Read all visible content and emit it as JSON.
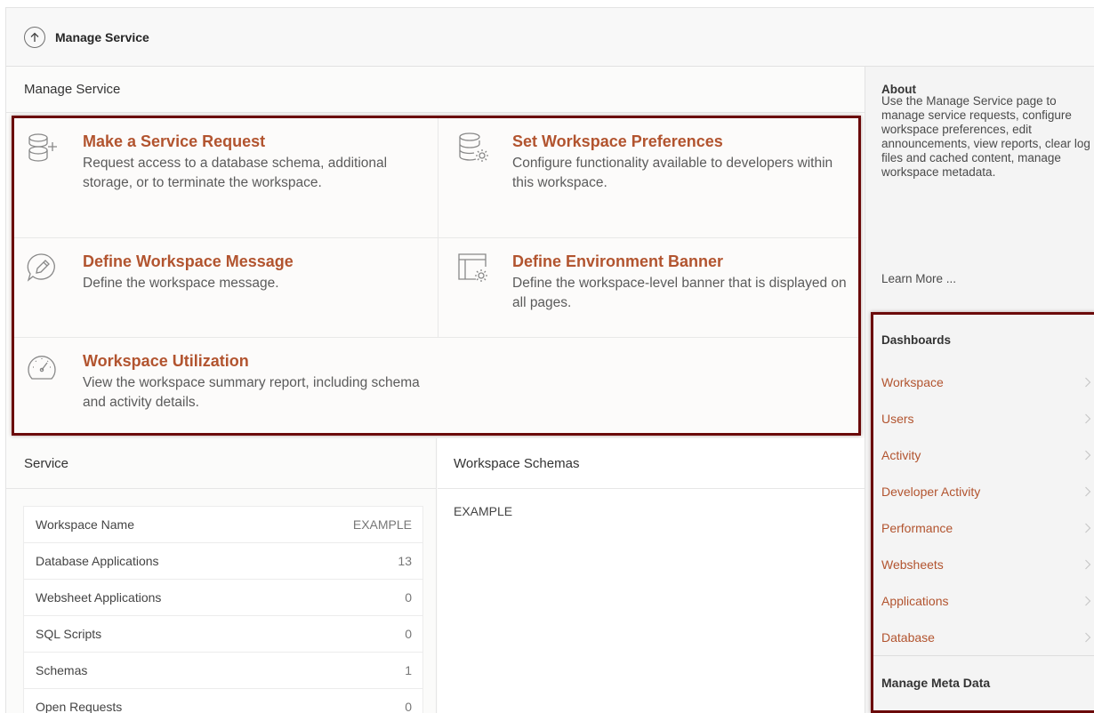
{
  "topbar": {
    "title": "Manage Service",
    "up_icon": "arrow-up-icon"
  },
  "main": {
    "header": "Manage Service",
    "cards": [
      {
        "title": "Make a Service Request",
        "description": "Request access to a database schema, additional storage, or to terminate the workspace.",
        "icon": "database-plus-icon"
      },
      {
        "title": "Set Workspace Preferences",
        "description": "Configure functionality available to developers within this workspace.",
        "icon": "database-gear-icon"
      },
      {
        "title": "Define Workspace Message",
        "description": "Define the workspace message.",
        "icon": "speech-pencil-icon"
      },
      {
        "title": "Define Environment Banner",
        "description": "Define the workspace-level banner that is displayed on all pages.",
        "icon": "window-gear-icon"
      },
      {
        "title": "Workspace Utilization",
        "description": "View the workspace summary report, including schema and activity details.",
        "icon": "gauge-icon"
      }
    ]
  },
  "service": {
    "header": "Service",
    "rows": [
      {
        "label": "Workspace Name",
        "value": "EXAMPLE"
      },
      {
        "label": "Database Applications",
        "value": "13"
      },
      {
        "label": "Websheet Applications",
        "value": "0"
      },
      {
        "label": "SQL Scripts",
        "value": "0"
      },
      {
        "label": "Schemas",
        "value": "1"
      },
      {
        "label": "Open Requests",
        "value": "0"
      }
    ]
  },
  "schemas": {
    "header": "Workspace Schemas",
    "items": [
      "EXAMPLE"
    ]
  },
  "about": {
    "header": "About",
    "text": "Use the Manage Service page to manage service requests, configure workspace preferences, edit announcements, view reports, clear log files and cached content, manage workspace metadata.",
    "learn_more": "Learn More ..."
  },
  "dashboards": {
    "header": "Dashboards",
    "items": [
      "Workspace",
      "Users",
      "Activity",
      "Developer Activity",
      "Performance",
      "Websheets",
      "Applications",
      "Database"
    ]
  },
  "meta": {
    "header": "Manage Meta Data"
  },
  "colors": {
    "accent": "#b2542f",
    "highlight_border": "#6b0a0a"
  }
}
